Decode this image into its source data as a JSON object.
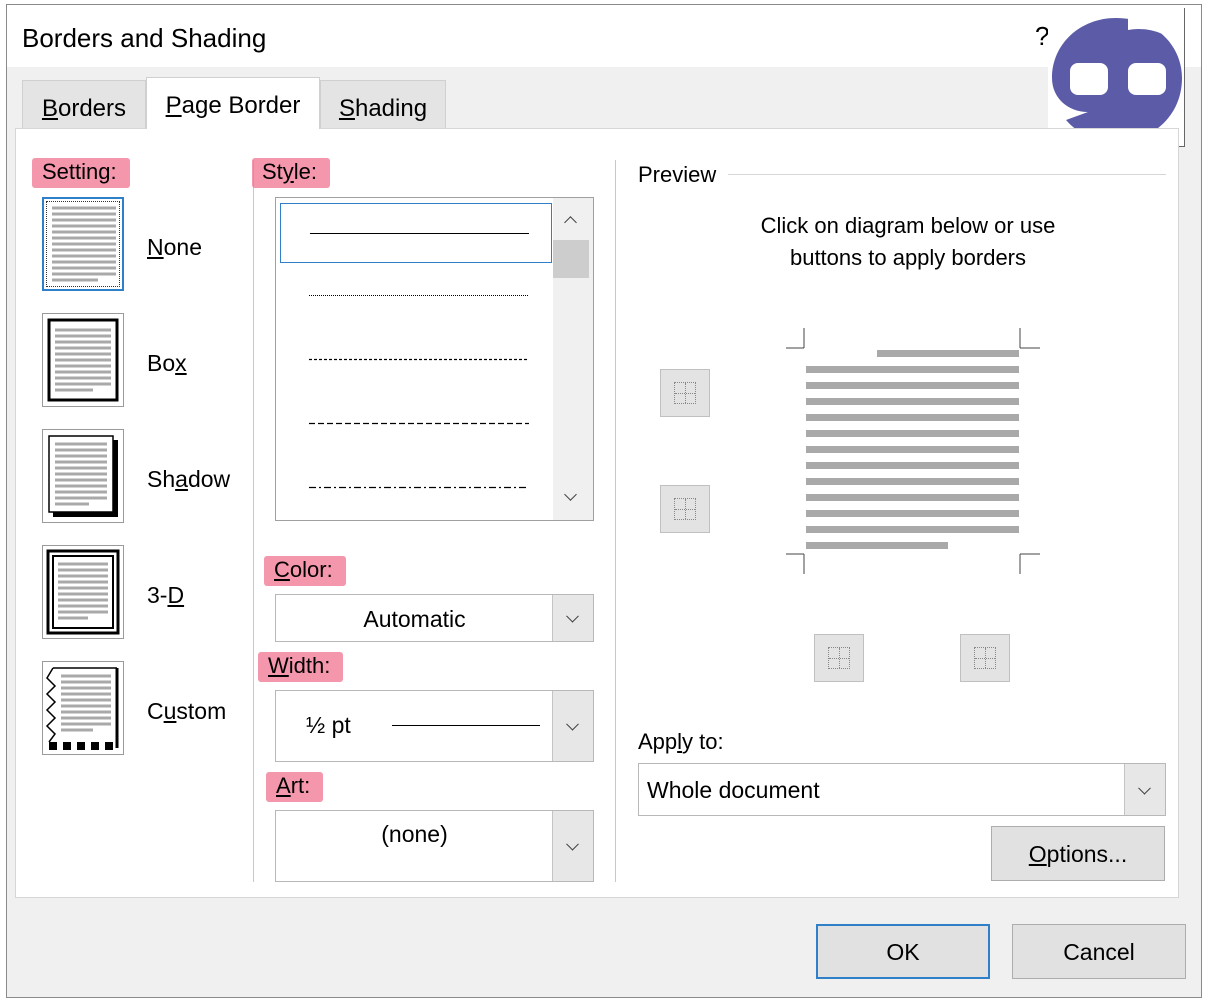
{
  "window": {
    "title": "Borders and Shading",
    "help": "?"
  },
  "tabs": [
    {
      "label": "Borders",
      "mnemonic": "B",
      "rest": "orders",
      "active": false
    },
    {
      "label": "Page Border",
      "mnemonic": "P",
      "rest": "age Border",
      "active": true
    },
    {
      "label": "Shading",
      "mnemonic": "S",
      "rest": "hading",
      "active": false
    }
  ],
  "setting": {
    "label": "Setting:",
    "selected": "None",
    "items": [
      {
        "pre": "",
        "mn": "N",
        "post": "one"
      },
      {
        "pre": "Bo",
        "mn": "x",
        "post": ""
      },
      {
        "pre": "Sh",
        "mn": "a",
        "post": "dow"
      },
      {
        "pre": "3-",
        "mn": "D",
        "post": ""
      },
      {
        "pre": "C",
        "mn": "u",
        "post": "stom"
      }
    ]
  },
  "style": {
    "label_pre": "St",
    "label_mn": "y",
    "label_post": "le:",
    "options": [
      "solid",
      "dotted",
      "dashed-small",
      "dashed",
      "dash-dot"
    ],
    "selected_index": 0
  },
  "color": {
    "label_mn": "C",
    "label_post": "olor:",
    "value": "Automatic"
  },
  "width": {
    "label_mn": "W",
    "label_post": "idth:",
    "value": "½ pt"
  },
  "art": {
    "label_pre": "",
    "label_mn": "A",
    "label_post": "rt:",
    "value": "(none)"
  },
  "preview": {
    "title": "Preview",
    "instructions_line1": "Click on diagram below or use",
    "instructions_line2": "buttons to apply borders"
  },
  "apply_to": {
    "label_pre": "App",
    "label_mn": "l",
    "label_post": "y to:",
    "value": "Whole document"
  },
  "buttons": {
    "options_mn": "O",
    "options_post": "ptions...",
    "ok": "OK",
    "cancel": "Cancel"
  },
  "colors": {
    "highlight": "#f06e8c",
    "selection_blue": "#2f7fc9",
    "logo": "#5b5ba8"
  }
}
